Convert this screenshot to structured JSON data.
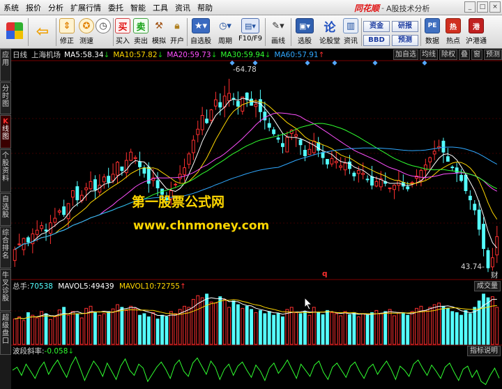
{
  "menu": [
    "系统",
    "报价",
    "分析",
    "扩展行情",
    "委托",
    "智能",
    "工具",
    "资讯",
    "帮助"
  ],
  "brand": {
    "logo": "同花顺",
    "separator": "-",
    "title": "A股技术分析"
  },
  "window_controls": [
    "_",
    "□",
    "×"
  ],
  "toolbar": {
    "buttons": [
      {
        "label": "",
        "icon": "grid-color-icon"
      },
      {
        "label": "",
        "icon": "back-arrow-icon"
      },
      {
        "label": "修正",
        "icon": "up-down-icon"
      },
      {
        "label": "测速",
        "icon": "speed-icon"
      },
      {
        "label": "买入",
        "icon": "buy-icon",
        "glyph": "买"
      },
      {
        "label": "卖出",
        "icon": "sell-icon",
        "glyph": "卖"
      },
      {
        "label": "模拟",
        "icon": "hammer-icon"
      },
      {
        "label": "开户",
        "icon": "lock-icon"
      },
      {
        "label": "自选股",
        "icon": "star-icon"
      },
      {
        "label": "周期",
        "icon": "clock-icon"
      },
      {
        "label": "F10/F9",
        "icon": "f10-icon"
      },
      {
        "label": "画线",
        "icon": "pen-icon"
      },
      {
        "label": "选股",
        "icon": "screen-icon"
      },
      {
        "label": "论股堂",
        "icon": "forum-icon",
        "glyph": "论"
      },
      {
        "label": "资讯",
        "icon": "news-icon"
      },
      {
        "label": "数据",
        "icon": "pe-icon",
        "glyph": "PE"
      },
      {
        "label": "热点",
        "icon": "hot-icon"
      },
      {
        "label": "沪港通",
        "icon": "hk-icon"
      }
    ],
    "small_buttons": [
      "资金",
      "研报",
      "BBD",
      "预测"
    ]
  },
  "left_tabs": [
    {
      "label": "应用"
    },
    {
      "label": "分时图"
    },
    {
      "label": "K线图",
      "highlight": "K",
      "active": true
    },
    {
      "label": "个股资料"
    },
    {
      "label": "自选股"
    },
    {
      "label": "综合排名"
    },
    {
      "label": "牛叉诊股"
    },
    {
      "label": "超级盘口"
    }
  ],
  "kline": {
    "period": "日线",
    "stock_name": "上海机场",
    "ma": [
      {
        "label": "MA5:",
        "value": "58.34",
        "arrow": "↓",
        "color": "#ffffff"
      },
      {
        "label": "MA10:",
        "value": "57.82",
        "arrow": "↓",
        "color": "#ffd700"
      },
      {
        "label": "MA20:",
        "value": "59.73",
        "arrow": "↓",
        "color": "#ff50ff"
      },
      {
        "label": "MA30:",
        "value": "59.94",
        "arrow": "↓",
        "color": "#30ff30"
      },
      {
        "label": "MA60:",
        "value": "57.91",
        "arrow": "↑",
        "color": "#30a8ff"
      }
    ],
    "buttons": [
      "加自选",
      "均线",
      "除权",
      "叠",
      "窗",
      "预测"
    ],
    "high_label": "64.78",
    "low_label": "43.74",
    "cai_label": "财",
    "q_label": "q"
  },
  "volume": {
    "title": "总手:",
    "value": "70538",
    "mavol5_label": "MAVOL5:",
    "mavol5": "49439",
    "mavol10_label": "MAVOL10:",
    "mavol10": "72755",
    "arrow": "↑",
    "button": "成交量"
  },
  "indicator": {
    "title": "波段斜率:",
    "value": "-0.058",
    "arrow": "↓",
    "button": "指标说明"
  },
  "watermark": {
    "line1": "第一股票公式网",
    "line2": "www.chnmoney.com"
  },
  "colors": {
    "up": "#ff3030",
    "down": "#54ffff",
    "ma5": "#ffffff",
    "ma10": "#ffd700",
    "ma20": "#ff50ff",
    "ma30": "#30ff30",
    "ma60": "#30a8ff",
    "indicator_line": "#30ff30",
    "grid": "#7a0000"
  },
  "chart_data": {
    "type": "candlestick",
    "price_range": [
      43,
      66
    ],
    "high": 64.78,
    "low": 43.74,
    "close_series": [
      46.2,
      46.8,
      47.4,
      47.0,
      47.9,
      48.3,
      48.8,
      48.2,
      49.1,
      49.6,
      50.4,
      50.0,
      51.2,
      52.6,
      51.6,
      52.1,
      52.9,
      53.6,
      52.7,
      53.2,
      54.1,
      53.5,
      54.4,
      55.7,
      54.8,
      55.9,
      56.8,
      56.2,
      55.2,
      54.5,
      53.4,
      54.0,
      52.9,
      52.2,
      51.6,
      52.6,
      53.3,
      54.4,
      55.1,
      56.6,
      58.1,
      59.3,
      60.8,
      60.0,
      61.4,
      62.5,
      61.7,
      62.9,
      63.2,
      62.6,
      61.8,
      62.8,
      62.5,
      61.9,
      62.0,
      61.2,
      60.3,
      59.5,
      58.8,
      58.2,
      57.4,
      58.4,
      59.2,
      58.7,
      57.6,
      56.4,
      57.1,
      58.0,
      57.0,
      56.2,
      55.5,
      56.1,
      55.8,
      55.3,
      55.6,
      55.0,
      54.2,
      54.8,
      54.5,
      53.8,
      53.2,
      53.6,
      53.9,
      53.4,
      52.9,
      53.2,
      53.7,
      53.1,
      52.8,
      53.5,
      54.2,
      54.8,
      55.4,
      56.2,
      56.9,
      57.4,
      56.8,
      55.8,
      55.1,
      54.6,
      53.7,
      52.6,
      51.6,
      50.5,
      48.4,
      46.3,
      44.2,
      45.3,
      47.6
    ],
    "volume_series": [
      48,
      52,
      45,
      60,
      55,
      50,
      62,
      58,
      47,
      52,
      65,
      70,
      55,
      62,
      58,
      50,
      68,
      72,
      60,
      55,
      58,
      62,
      67,
      75,
      70,
      64,
      72,
      68,
      55,
      58,
      52,
      60,
      48,
      55,
      52,
      62,
      58,
      66,
      72,
      70,
      85,
      92,
      88,
      95,
      80,
      78,
      90,
      85,
      70,
      82,
      75,
      68,
      72,
      66,
      60,
      64,
      58,
      62,
      55,
      58,
      52,
      66,
      70,
      60,
      58,
      62,
      55,
      70,
      60,
      56,
      64,
      60,
      58,
      54,
      62,
      56,
      60,
      52,
      58,
      55,
      60,
      64,
      58,
      62,
      66,
      54,
      60,
      58,
      55,
      62,
      68,
      72,
      64,
      70,
      75,
      78,
      72,
      68,
      62,
      60,
      55,
      64,
      58,
      70,
      82,
      95,
      88,
      90,
      70
    ],
    "indicator_series": [
      0.02,
      0.05,
      -0.03,
      0.08,
      0.01,
      -0.06,
      0.04,
      0.1,
      -0.02,
      0.06,
      0.12,
      0.03,
      -0.05,
      0.07,
      0.15,
      0.04,
      -0.08,
      0.02,
      0.11,
      0.05,
      -0.04,
      0.09,
      0.01,
      -0.07,
      0.06,
      0.13,
      0.02,
      -0.03,
      0.08,
      0.04,
      -0.09,
      -0.02,
      0.05,
      0.1,
      0.03,
      -0.06,
      0.07,
      0.12,
      0.01,
      -0.04,
      0.09,
      0.14,
      0.06,
      -0.02,
      0.11,
      0.05,
      -0.07,
      0.03,
      0.08,
      -0.03,
      0.06,
      0.1,
      0.02,
      -0.05,
      0.07,
      0.01,
      -0.08,
      0.04,
      0.09,
      -0.01,
      0.05,
      0.12,
      0.03,
      -0.06,
      0.08,
      0.02,
      -0.04,
      0.07,
      0.11,
      0.0,
      -0.07,
      0.05,
      0.09,
      0.02,
      -0.05,
      0.06,
      0.1,
      0.01,
      -0.06,
      0.04,
      0.08,
      -0.02,
      0.05,
      0.11,
      0.03,
      -0.07,
      0.06,
      0.02,
      -0.04,
      0.08,
      0.12,
      0.04,
      -0.03,
      0.07,
      0.01,
      -0.06,
      0.05,
      0.09,
      0.0,
      -0.08,
      0.03,
      0.06,
      -0.05,
      0.02,
      -0.09,
      -0.12,
      -0.03,
      0.04,
      -0.058
    ]
  }
}
